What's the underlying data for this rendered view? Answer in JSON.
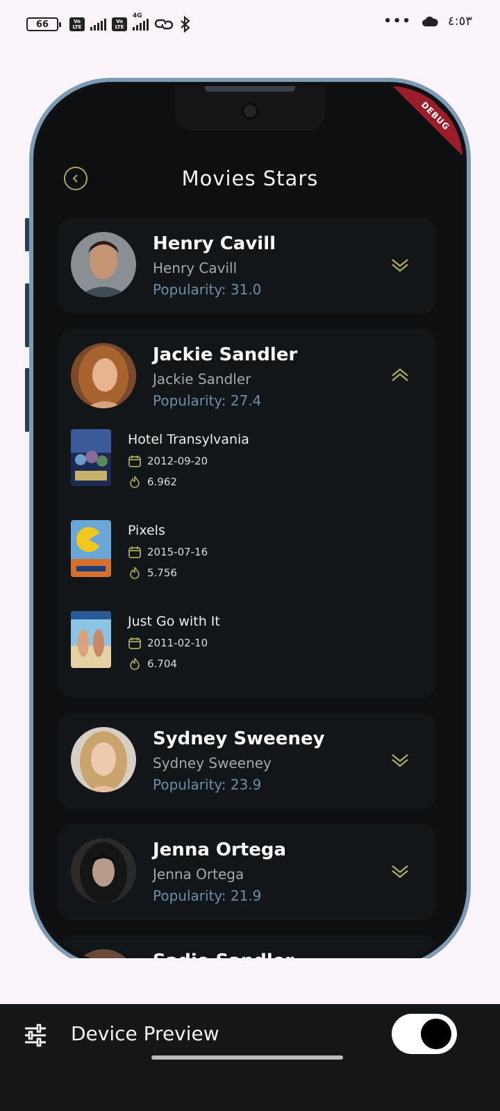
{
  "status_bar": {
    "battery": "66",
    "volte1": "Vo LTE",
    "volte2": "Vo LTE",
    "network": "4G",
    "time": "٤:٥٣"
  },
  "app": {
    "title": "Movies Stars",
    "debug_banner": "DEBUG"
  },
  "actors": [
    {
      "name": "Henry Cavill",
      "subtitle": "Henry Cavill",
      "popularity": "Popularity: 31.0",
      "expanded": false
    },
    {
      "name": "Jackie Sandler",
      "subtitle": "Jackie Sandler",
      "popularity": "Popularity: 27.4",
      "expanded": true,
      "movies": [
        {
          "title": "Hotel Transylvania",
          "date": "2012-09-20",
          "rating": "6.962"
        },
        {
          "title": "Pixels",
          "date": "2015-07-16",
          "rating": "5.756"
        },
        {
          "title": "Just Go with It",
          "date": "2011-02-10",
          "rating": "6.704"
        }
      ]
    },
    {
      "name": "Sydney Sweeney",
      "subtitle": "Sydney Sweeney",
      "popularity": "Popularity: 23.9",
      "expanded": false
    },
    {
      "name": "Jenna Ortega",
      "subtitle": "Jenna Ortega",
      "popularity": "Popularity: 21.9",
      "expanded": false
    },
    {
      "name": "Sadie Sandler",
      "subtitle": "",
      "popularity": "",
      "expanded": false
    }
  ],
  "device_preview": {
    "label": "Device Preview",
    "enabled": true
  },
  "colors": {
    "accent": "#a8ad5e",
    "popularity": "#6f8ea3",
    "frame": "#7d9bb4",
    "debug": "#9b1c2a"
  }
}
